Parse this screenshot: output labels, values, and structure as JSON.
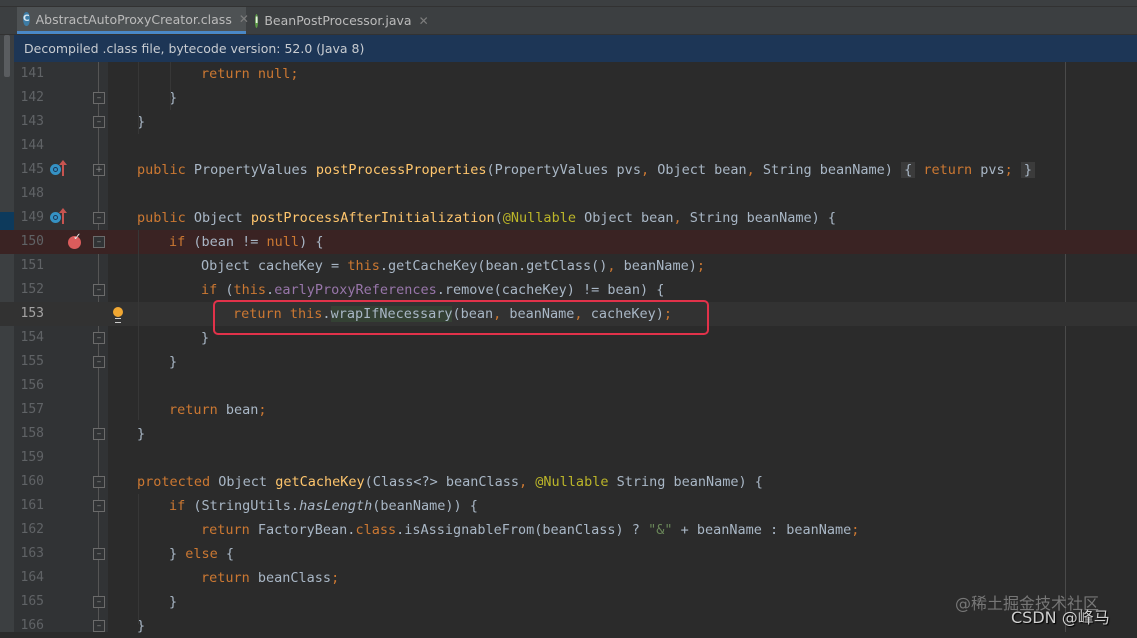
{
  "tabs": [
    {
      "label": "AbstractAutoProxyCreator.class",
      "icon": "class-icon",
      "icon_letter": "C",
      "active": true
    },
    {
      "label": "BeanPostProcessor.java",
      "icon": "interface-icon",
      "icon_letter": "I",
      "active": false
    }
  ],
  "banner": {
    "text": "Decompiled .class file, bytecode version: 52.0 (Java 8)"
  },
  "line_numbers": [
    "141",
    "142",
    "143",
    "144",
    "145",
    "148",
    "149",
    "150",
    "151",
    "152",
    "153",
    "154",
    "155",
    "156",
    "157",
    "158",
    "159",
    "160",
    "161",
    "162",
    "163",
    "164",
    "165",
    "166"
  ],
  "current_line": "153",
  "breakpoint_line": "150",
  "code_lines": {
    "l141": [
      {
        "t": "return ",
        "c": "kw"
      },
      {
        "t": "null",
        "c": "kw"
      },
      {
        "t": ";",
        "c": "cm"
      }
    ],
    "l142": [
      {
        "t": "}",
        "c": ""
      }
    ],
    "l143": [
      {
        "t": "}",
        "c": ""
      }
    ],
    "l145": [
      {
        "t": "public ",
        "c": "kw"
      },
      {
        "t": "PropertyValues ",
        "c": ""
      },
      {
        "t": "postProcessProperties",
        "c": "fn"
      },
      {
        "t": "(PropertyValues pvs",
        "c": ""
      },
      {
        "t": ", ",
        "c": "cm"
      },
      {
        "t": "Object bean",
        "c": ""
      },
      {
        "t": ", ",
        "c": "cm"
      },
      {
        "t": "String beanName) ",
        "c": ""
      },
      {
        "t": "{",
        "c": "fb"
      },
      {
        "t": " ",
        "c": ""
      },
      {
        "t": "return ",
        "c": "kw"
      },
      {
        "t": "pvs",
        "c": ""
      },
      {
        "t": ";",
        "c": "cm"
      },
      {
        "t": " ",
        "c": ""
      },
      {
        "t": "}",
        "c": "fb"
      }
    ],
    "l149": [
      {
        "t": "public ",
        "c": "kw"
      },
      {
        "t": "Object ",
        "c": ""
      },
      {
        "t": "postProcessAfterInitialization",
        "c": "fn"
      },
      {
        "t": "(",
        "c": ""
      },
      {
        "t": "@Nullable",
        "c": "an"
      },
      {
        "t": " Object bean",
        "c": ""
      },
      {
        "t": ", ",
        "c": "cm"
      },
      {
        "t": "String beanName) {",
        "c": ""
      }
    ],
    "l150": [
      {
        "t": "if ",
        "c": "kw"
      },
      {
        "t": "(bean != ",
        "c": ""
      },
      {
        "t": "null",
        "c": "kw"
      },
      {
        "t": ") {",
        "c": ""
      }
    ],
    "l151": [
      {
        "t": "Object cacheKey = ",
        "c": ""
      },
      {
        "t": "this",
        "c": "kw"
      },
      {
        "t": ".getCacheKey(bean.getClass()",
        "c": ""
      },
      {
        "t": ", ",
        "c": "cm"
      },
      {
        "t": "beanName)",
        "c": ""
      },
      {
        "t": ";",
        "c": "cm"
      }
    ],
    "l152": [
      {
        "t": "if ",
        "c": "kw"
      },
      {
        "t": "(",
        "c": ""
      },
      {
        "t": "this",
        "c": "kw"
      },
      {
        "t": ".",
        "c": ""
      },
      {
        "t": "earlyProxyReferences",
        "c": "fd"
      },
      {
        "t": ".remove(cacheKey) != bean) {",
        "c": ""
      }
    ],
    "l153": [
      {
        "t": "return ",
        "c": "kw"
      },
      {
        "t": "this",
        "c": "kw"
      },
      {
        "t": ".",
        "c": ""
      },
      {
        "t": "wrapIfNecessary",
        "c": "hl"
      },
      {
        "t": "(bean",
        "c": ""
      },
      {
        "t": ", ",
        "c": "cm"
      },
      {
        "t": "beanName",
        "c": ""
      },
      {
        "t": ", ",
        "c": "cm"
      },
      {
        "t": "cacheKey)",
        "c": ""
      },
      {
        "t": ";",
        "c": "cm"
      }
    ],
    "l154": [
      {
        "t": "}",
        "c": ""
      }
    ],
    "l155": [
      {
        "t": "}",
        "c": ""
      }
    ],
    "l157": [
      {
        "t": "return ",
        "c": "kw"
      },
      {
        "t": "bean",
        "c": ""
      },
      {
        "t": ";",
        "c": "cm"
      }
    ],
    "l158": [
      {
        "t": "}",
        "c": ""
      }
    ],
    "l160": [
      {
        "t": "protected ",
        "c": "kw"
      },
      {
        "t": "Object ",
        "c": ""
      },
      {
        "t": "getCacheKey",
        "c": "fn"
      },
      {
        "t": "(Class<?> beanClass",
        "c": ""
      },
      {
        "t": ", ",
        "c": "cm"
      },
      {
        "t": "@Nullable",
        "c": "an"
      },
      {
        "t": " String beanName) {",
        "c": ""
      }
    ],
    "l161": [
      {
        "t": "if ",
        "c": "kw"
      },
      {
        "t": "(StringUtils.",
        "c": ""
      },
      {
        "t": "hasLength",
        "c": "it"
      },
      {
        "t": "(beanName)) {",
        "c": ""
      }
    ],
    "l162": [
      {
        "t": "return ",
        "c": "kw"
      },
      {
        "t": "FactoryBean.",
        "c": ""
      },
      {
        "t": "class",
        "c": "kw"
      },
      {
        "t": ".isAssignableFrom(beanClass) ? ",
        "c": ""
      },
      {
        "t": "\"&\"",
        "c": "st"
      },
      {
        "t": " + beanName : beanName",
        "c": ""
      },
      {
        "t": ";",
        "c": "cm"
      }
    ],
    "l163": [
      {
        "t": "} ",
        "c": ""
      },
      {
        "t": "else ",
        "c": "kw"
      },
      {
        "t": "{",
        "c": ""
      }
    ],
    "l164": [
      {
        "t": "return ",
        "c": "kw"
      },
      {
        "t": "beanClass",
        "c": ""
      },
      {
        "t": ";",
        "c": "cm"
      }
    ],
    "l165": [
      {
        "t": "}",
        "c": ""
      }
    ],
    "l166": [
      {
        "t": "}",
        "c": ""
      }
    ]
  },
  "watermark": {
    "line1": "@稀土掘金技术社区",
    "line2": "CSDN @峰马"
  }
}
